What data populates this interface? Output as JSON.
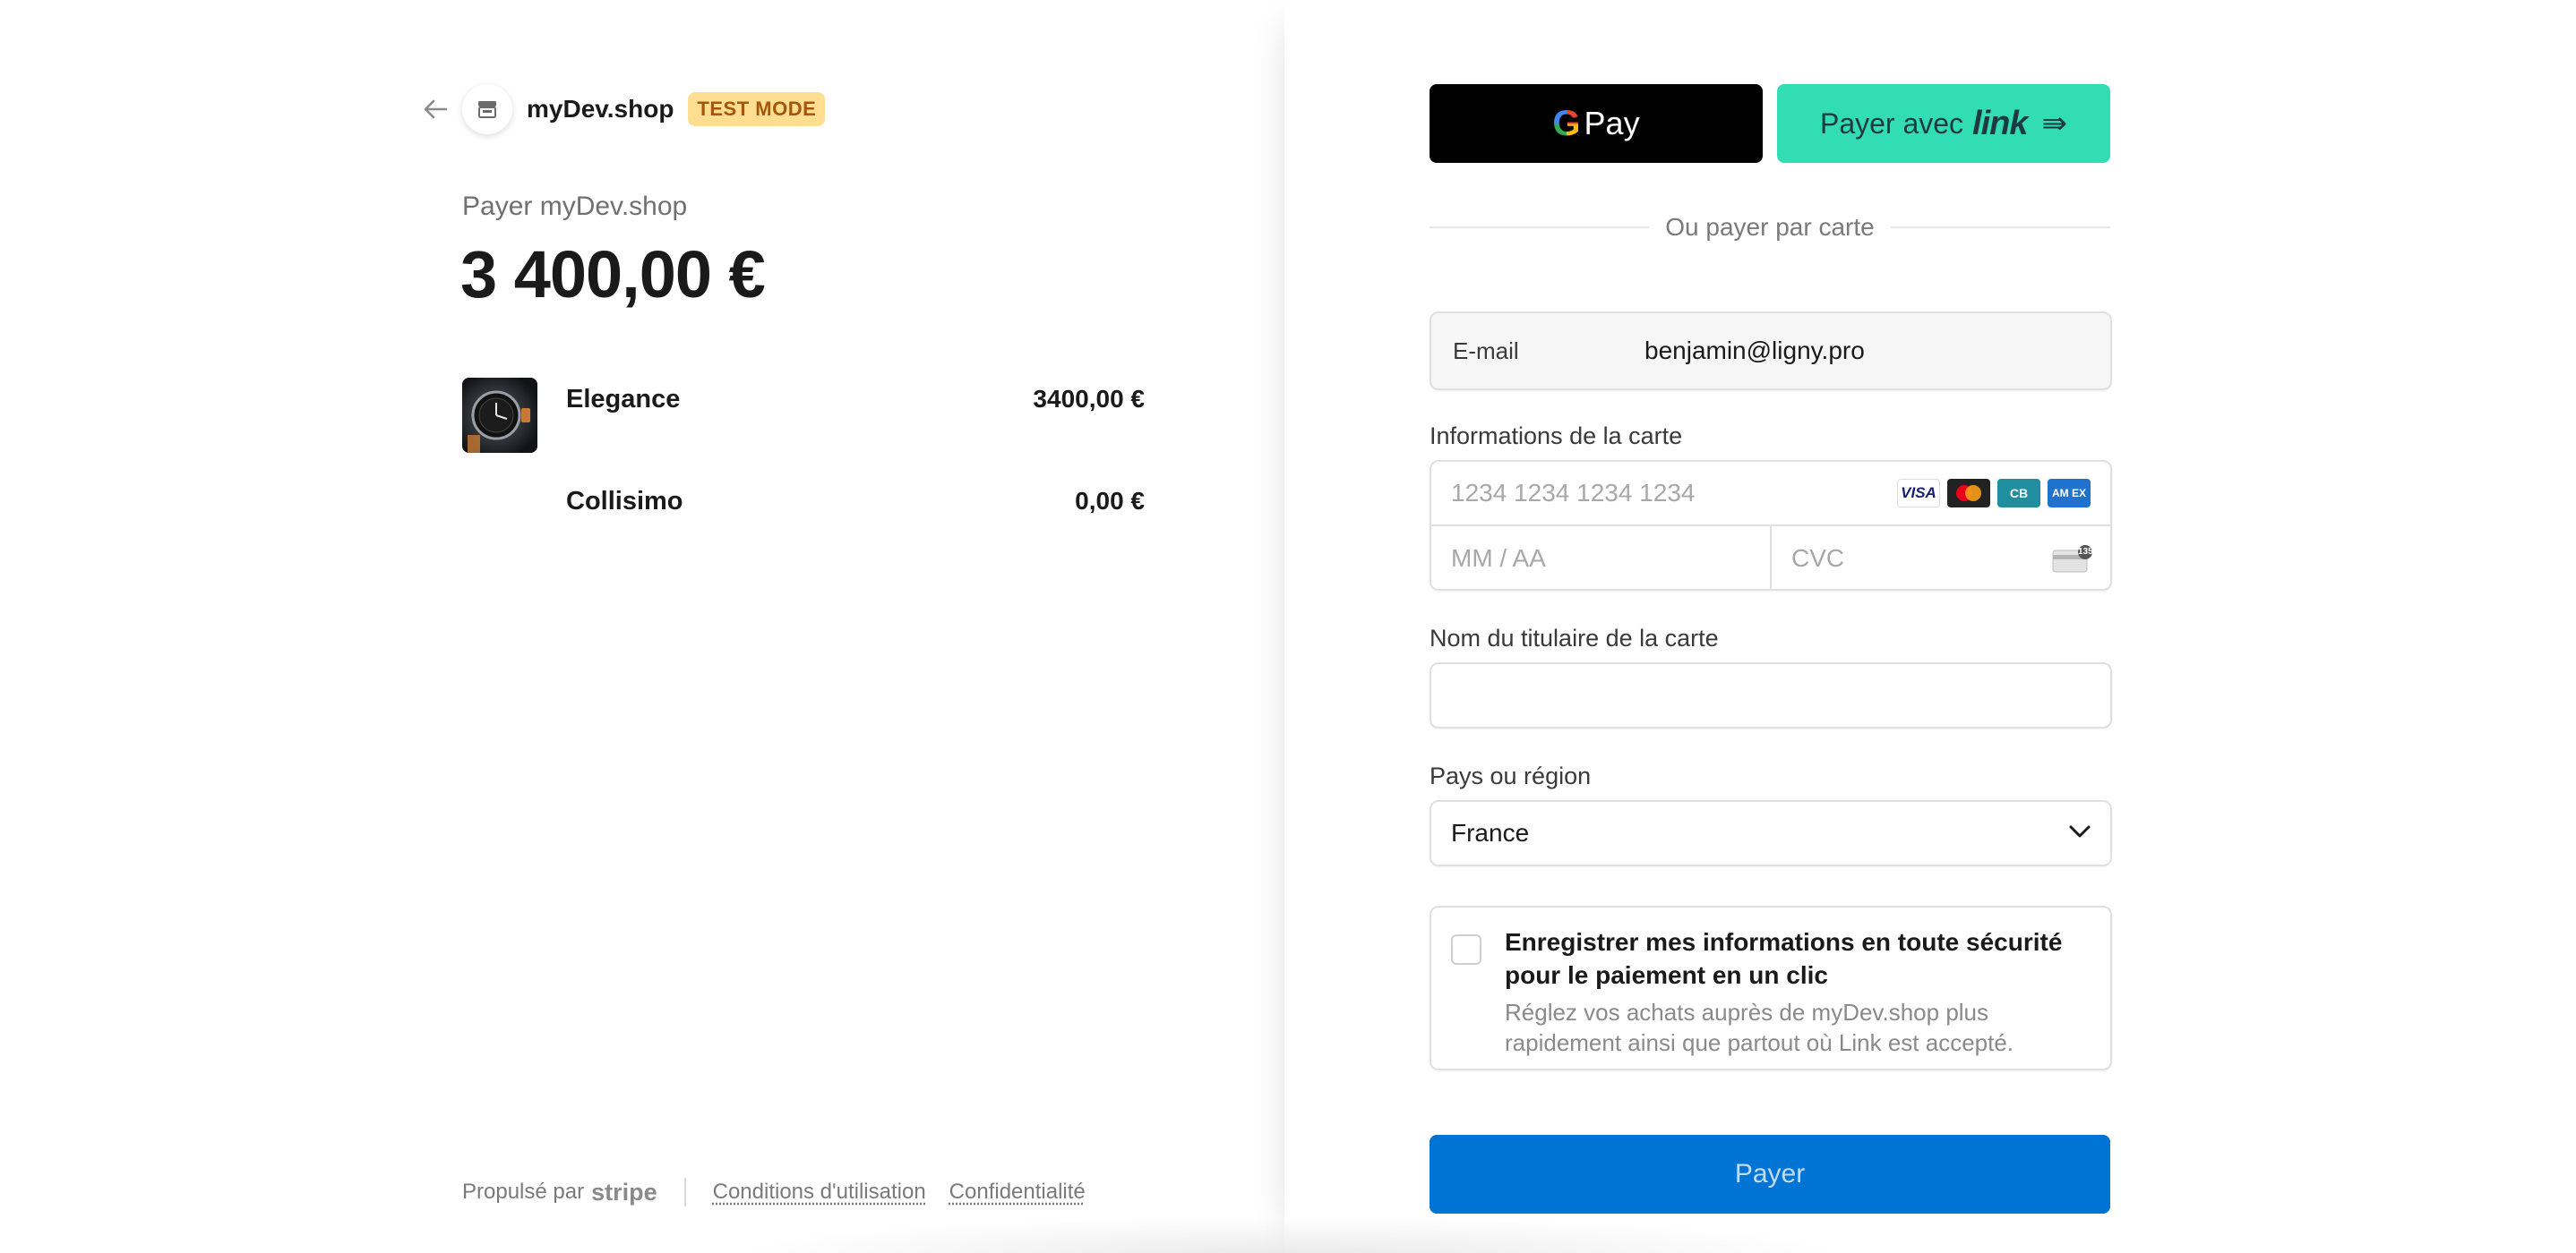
{
  "header": {
    "shop_name": "myDev.shop",
    "badge": "TEST MODE"
  },
  "summary": {
    "pay_label": "Payer myDev.shop",
    "amount": "3 400,00 €",
    "items": [
      {
        "name": "Elegance",
        "price": "3400,00 €",
        "icon": "watch-thumbnail"
      },
      {
        "name": "Collisimo",
        "price": "0,00 €"
      }
    ]
  },
  "footer": {
    "powered_by": "Propulsé par",
    "brand": "stripe",
    "terms": "Conditions d'utilisation",
    "privacy": "Confidentialité"
  },
  "wallets": {
    "gpay_g": "G",
    "gpay_label": "Pay",
    "link_prefix": "Payer avec",
    "link_word": "link",
    "link_arrow": "⇛"
  },
  "divider_text": "Ou payer par carte",
  "form": {
    "email_label": "E-mail",
    "email_value": "benjamin@ligny.pro",
    "card_label": "Informations de la carte",
    "card_number_placeholder": "1234 1234 1234 1234",
    "expiry_placeholder": "MM / AA",
    "cvc_placeholder": "CVC",
    "card_brands": [
      "VISA",
      "",
      "CB",
      "AM EX"
    ],
    "cvc_icon_text": "135",
    "holder_label": "Nom du titulaire de la carte",
    "holder_value": "",
    "country_label": "Pays ou région",
    "country_value": "France",
    "save_title": "Enregistrer mes informations en toute sécurité pour le paiement en un clic",
    "save_desc": "Réglez vos achats auprès de myDev.shop plus rapidement ainsi que partout où Link est accepté.",
    "pay_button": "Payer"
  },
  "colors": {
    "pay_button": "#0074d4",
    "link_button": "#33ddb3",
    "badge_bg": "#ffde92",
    "badge_text": "#a4570a"
  }
}
